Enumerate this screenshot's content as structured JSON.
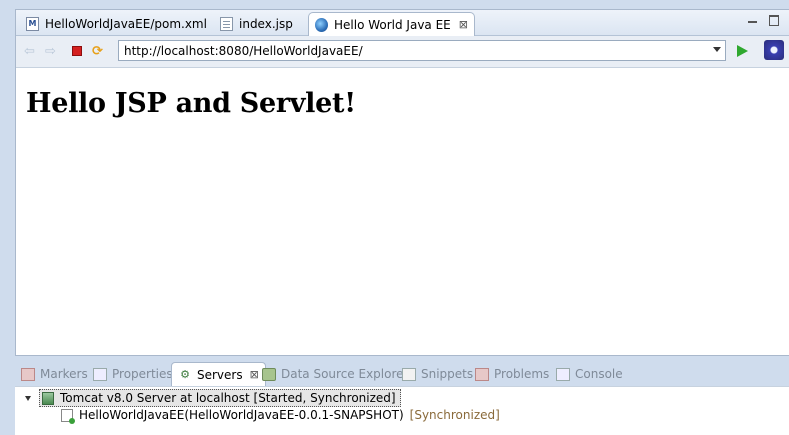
{
  "editor": {
    "tabs": [
      {
        "label": "HelloWorldJavaEE/pom.xml",
        "icon": "maven-pom-icon"
      },
      {
        "label": "index.jsp",
        "icon": "file-icon"
      },
      {
        "label": "Hello World Java EE",
        "icon": "globe-icon",
        "active": true
      }
    ],
    "close_glyph": "⊠",
    "maven_glyph": "M"
  },
  "browser": {
    "url": "http://localhost:8080/HelloWorldJavaEE/",
    "back_glyph": "⇦",
    "forward_glyph": "⇨",
    "refresh_glyph": "⟳"
  },
  "page": {
    "heading": "Hello JSP and Servlet!"
  },
  "bottom_tabs": [
    {
      "label": "Markers",
      "icon": "markers-icon"
    },
    {
      "label": "Properties",
      "icon": "properties-icon"
    },
    {
      "label": "Servers",
      "icon": "servers-icon",
      "active": true
    },
    {
      "label": "Data Source Explorer",
      "icon": "data-source-icon"
    },
    {
      "label": "Snippets",
      "icon": "snippets-icon"
    },
    {
      "label": "Problems",
      "icon": "problems-icon"
    },
    {
      "label": "Console",
      "icon": "console-icon"
    }
  ],
  "servers": {
    "server_label": "Tomcat v8.0 Server at localhost  [Started, Synchronized]",
    "module_label": "HelloWorldJavaEE(HelloWorldJavaEE-0.0.1-SNAPSHOT)",
    "module_status": "[Synchronized]",
    "servers_glyph": "⚙"
  },
  "colors": {
    "background": "#cfdced",
    "stop": "#d42020",
    "go": "#2fa82f",
    "sync_status": "#8a6a3a"
  }
}
